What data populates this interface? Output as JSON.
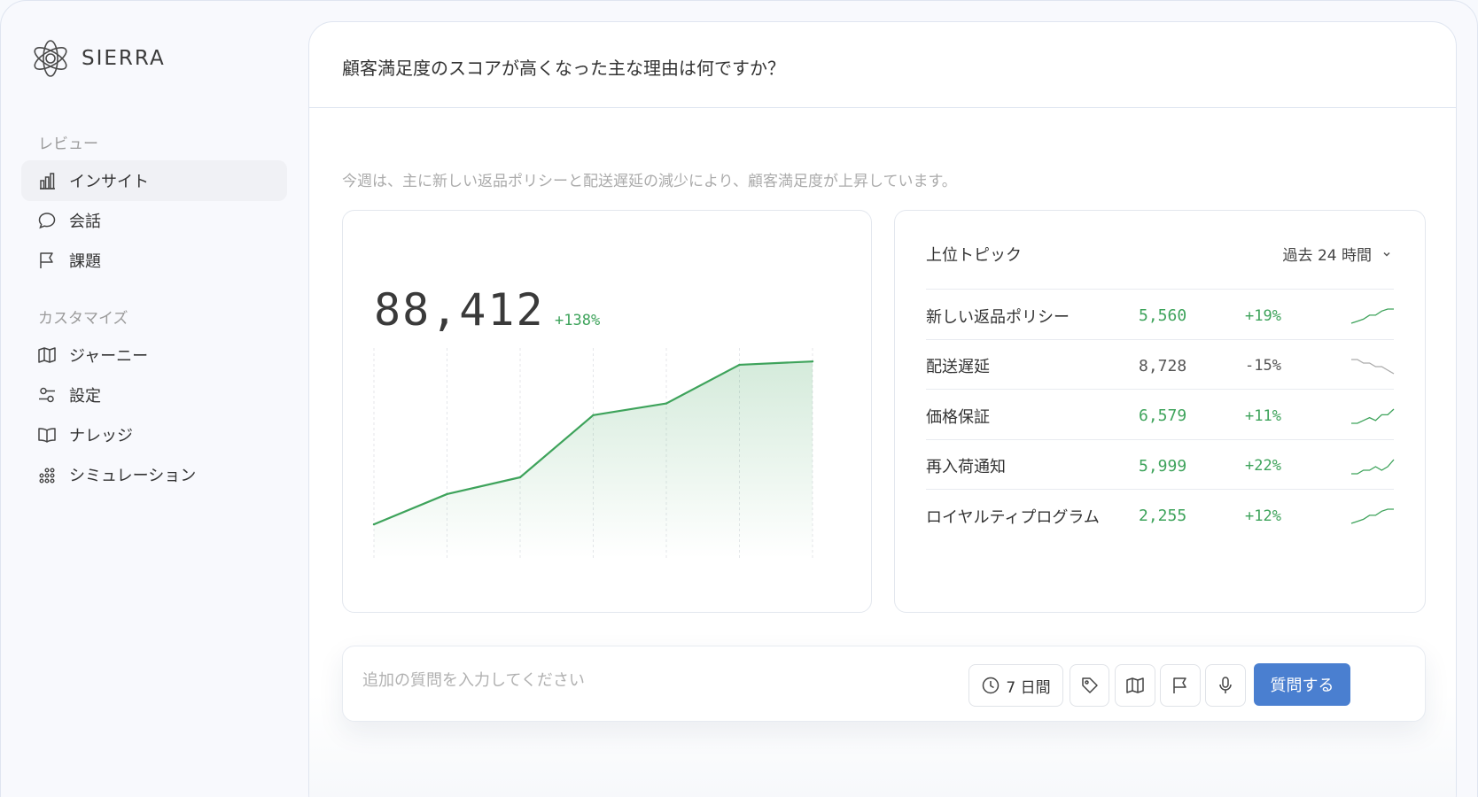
{
  "app": {
    "brand": "SIERRA"
  },
  "sidebar": {
    "review_label": "レビュー",
    "customize_label": "カスタマイズ",
    "review_items": [
      {
        "label": "インサイト",
        "icon": "bar-chart-icon",
        "active": true
      },
      {
        "label": "会話",
        "icon": "chat-bubble-icon",
        "active": false
      },
      {
        "label": "課題",
        "icon": "flag-icon",
        "active": false
      }
    ],
    "customize_items": [
      {
        "label": "ジャーニー",
        "icon": "map-icon"
      },
      {
        "label": "設定",
        "icon": "sliders-icon"
      },
      {
        "label": "ナレッジ",
        "icon": "book-icon"
      },
      {
        "label": "シミュレーション",
        "icon": "dots-grid-icon"
      }
    ]
  },
  "main": {
    "question": "顧客満足度のスコアが高くなった主な理由は何ですか？",
    "answer": "今週は、主に新しい返品ポリシーと配送遅延の減少により、顧客満足度が上昇しています。"
  },
  "metric": {
    "value": "88,412",
    "change": "+138%"
  },
  "chart_data": {
    "type": "area",
    "title": "",
    "xlabel": "",
    "ylabel": "",
    "x": [
      1,
      2,
      3,
      4,
      5,
      6,
      7
    ],
    "series": [
      {
        "values": [
          20,
          38,
          48,
          85,
          92,
          115,
          117
        ]
      }
    ],
    "ylim": [
      0,
      125
    ],
    "grid": "vertical-dashed",
    "color": "#3ea35b"
  },
  "topics": {
    "title": "上位トピック",
    "period": "過去 24 時間",
    "rows": [
      {
        "name": "新しい返品ポリシー",
        "count": "5,560",
        "change": "+19%",
        "trend": "up",
        "spark": [
          2,
          3,
          4,
          6,
          6,
          8,
          9,
          9
        ]
      },
      {
        "name": "配送遅延",
        "count": "8,728",
        "change": "-15%",
        "trend": "down",
        "spark": [
          8,
          8,
          7,
          7,
          6,
          6,
          5,
          4
        ]
      },
      {
        "name": "価格保証",
        "count": "6,579",
        "change": "+11%",
        "trend": "up",
        "spark": [
          3,
          3,
          4,
          5,
          4,
          6,
          6,
          8
        ]
      },
      {
        "name": "再入荷通知",
        "count": "5,999",
        "change": "+22%",
        "trend": "up",
        "spark": [
          3,
          3,
          4,
          4,
          5,
          4,
          5,
          7
        ]
      },
      {
        "name": "ロイヤルティプログラム",
        "count": "2,255",
        "change": "+12%",
        "trend": "up",
        "spark": [
          1,
          2,
          3,
          5,
          5,
          7,
          8,
          8
        ]
      }
    ]
  },
  "composer": {
    "placeholder": "追加の質問を入力してください",
    "range_label": "7 日間",
    "submit_label": "質問する"
  },
  "colors": {
    "positive": "#3ea35b",
    "primary": "#4a7fd0"
  }
}
